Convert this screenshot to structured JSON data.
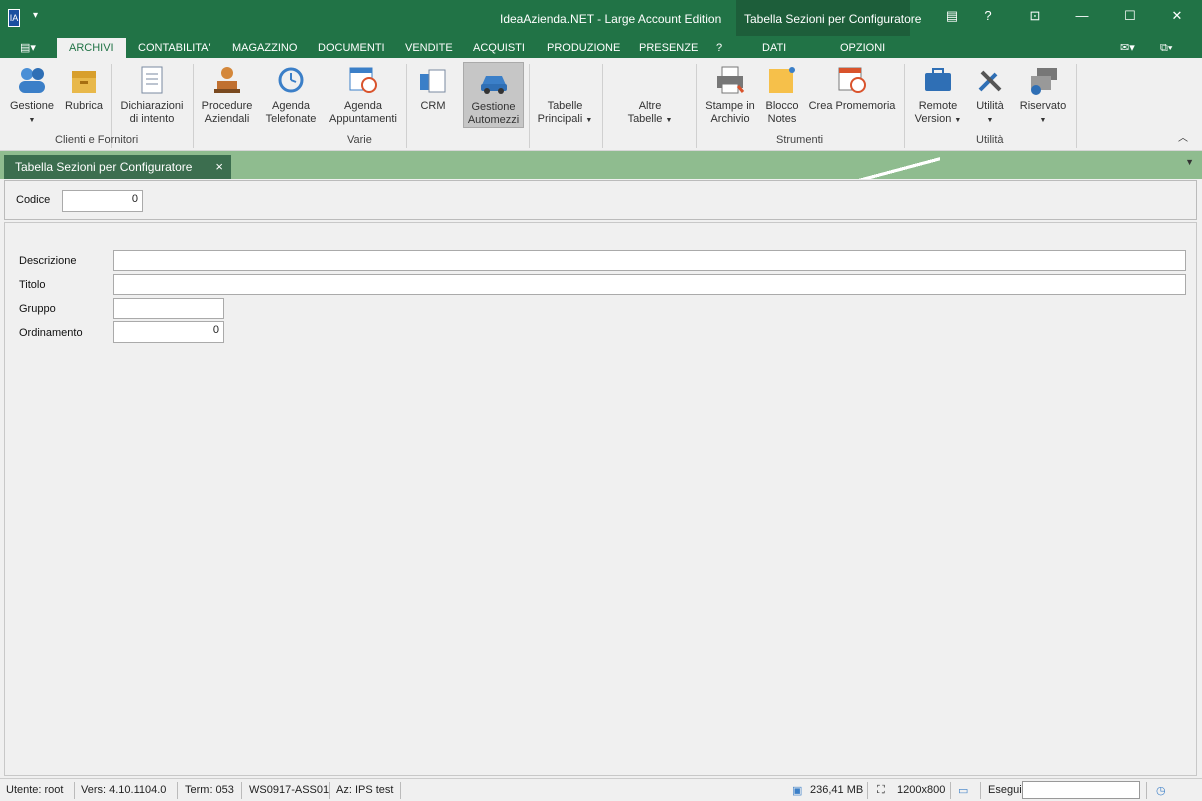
{
  "window": {
    "app_title": "IdeaAzienda.NET - Large Account Edition",
    "context_title": "Tabella Sezioni per Configuratore",
    "icon_text": "IA"
  },
  "ribbon_tabs": [
    "ARCHIVI",
    "CONTABILITA'",
    "MAGAZZINO",
    "DOCUMENTI",
    "VENDITE",
    "ACQUISTI",
    "PRODUZIONE",
    "PRESENZE",
    "?",
    "DATI",
    "OPZIONI"
  ],
  "ribbon": {
    "gestione": "Gestione",
    "rubrica": "Rubrica",
    "dichiarazioni_1": "Dichiarazioni",
    "dichiarazioni_2": "di intento",
    "procedure_1": "Procedure",
    "procedure_2": "Aziendali",
    "agenda_tel_1": "Agenda",
    "agenda_tel_2": "Telefonate",
    "agenda_app_1": "Agenda",
    "agenda_app_2": "Appuntamenti",
    "crm": "CRM",
    "automezzi_1": "Gestione",
    "automezzi_2": "Automezzi",
    "tabelle_1": "Tabelle",
    "tabelle_2": "Principali",
    "altre_1": "Altre",
    "altre_2": "Tabelle",
    "stampe_1": "Stampe in",
    "stampe_2": "Archivio",
    "blocco_1": "Blocco",
    "blocco_2": "Notes",
    "promemoria": "Crea Promemoria",
    "remote_1": "Remote",
    "remote_2": "Version",
    "utilita": "Utilità",
    "riservato": "Riservato",
    "groups": {
      "clienti": "Clienti e Fornitori",
      "varie": "Varie",
      "strumenti": "Strumenti",
      "utilita": "Utilità"
    }
  },
  "doc_tab": {
    "label": "Tabella Sezioni per Configuratore",
    "close": "×"
  },
  "form": {
    "codice_label": "Codice",
    "codice_value": "0",
    "descrizione_label": "Descrizione",
    "descrizione_value": "",
    "titolo_label": "Titolo",
    "titolo_value": "",
    "gruppo_label": "Gruppo",
    "gruppo_value": "",
    "ordinamento_label": "Ordinamento",
    "ordinamento_value": "0"
  },
  "status": {
    "utente": "Utente: root",
    "versione": "Vers: 4.10.1104.0",
    "term": "Term: 053",
    "ws": "WS0917-ASS01",
    "az": "Az: IPS test",
    "memory": "236,41 MB",
    "resolution": "1200x800",
    "esegui_label": "Esegui",
    "esegui_value": ""
  },
  "colors": {
    "accent": "#217346",
    "doc_strip": "#8fbc8f",
    "doc_tab": "#3c6e4f"
  }
}
